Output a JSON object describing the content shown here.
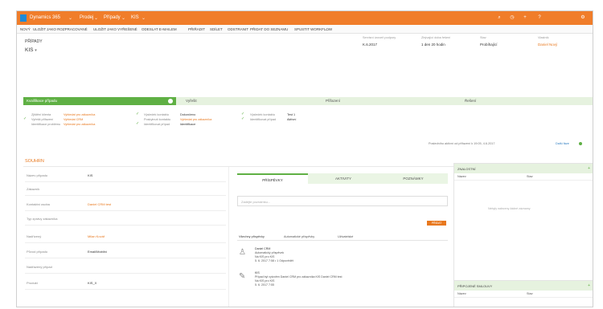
{
  "nav": {
    "app_name": "Dynamics 365",
    "area": "Prodej",
    "entity": "Případy",
    "record": "KIS",
    "right_icons": [
      "search-icon",
      "history-icon",
      "add-icon",
      "help-icon",
      "settings-icon"
    ]
  },
  "commands": [
    "NOVÝ",
    "ULOŽIT JAKO ROZPRACOVANÉ",
    "ULOŽIT JAKO VYŘEŠENÉ",
    "ODESLAT E-MAILEM",
    "PŘIŘADIT",
    "SDÍLET",
    "ODSTRANIT",
    "PŘIDAT DO SEZNAMU",
    "SPUSTIT WORKFLOW",
    "..."
  ],
  "header": {
    "entity_label": "PŘÍPADY",
    "record_name": "KIS",
    "fields": [
      {
        "label": "Servisní úroveň podpory",
        "value": "K.6.2017"
      },
      {
        "label": "Zbývající doba řešení",
        "value": "1 den 20 hodin"
      },
      {
        "label": "Stav",
        "value": "Probíhající"
      },
      {
        "label": "Vlastník",
        "value": "Daniel Nový",
        "orange": true
      }
    ]
  },
  "process": {
    "stages": [
      "Kvalifikace případu",
      "Vyřešit",
      "Přiřazení",
      "Řešení"
    ],
    "active_stage": 0,
    "col1": [
      {
        "label": "Zjištění klienta",
        "value": "Vyhledat pro zákazníka"
      },
      {
        "label": "Vyřešit přiřazení",
        "value": "Vyhledat CRM"
      },
      {
        "label": "Identifikace problému",
        "value": "Vyhledat pro zákazníka"
      }
    ],
    "col2": [
      {
        "label": "Výsledek kontaktu",
        "value": "Dokončeno"
      },
      {
        "label": "Poskytnutí kontaktu",
        "value": "Vyhledat pro zákazníka"
      },
      {
        "label": "Identifikovat případ",
        "value": "Identifikace"
      }
    ],
    "col3": [
      {
        "label": "Výsledek kontaktu",
        "value": "Test 1"
      },
      {
        "label": "Identifikovat případ",
        "value": "Aktivní"
      }
    ],
    "note": "Posledního aktivní od přiřazení k 19:05, 4.6.2017",
    "link": "Další fáze"
  },
  "summary": {
    "title": "SOUHRN",
    "fields": [
      {
        "label": "Název případu",
        "value": "KIS",
        "orange": false
      },
      {
        "label": "Zákazník",
        "value": "",
        "orange": false
      },
      {
        "label": "Kontaktní osoba",
        "value": "Daniel CRM test",
        "orange": true
      },
      {
        "label": "Typ zprávy zákazníka",
        "value": "",
        "orange": false
      },
      {
        "label": "Nadřízený",
        "value": "Milan Kovář",
        "orange": true
      },
      {
        "label": "Původ případu",
        "value": "Email/Mobilní",
        "orange": false
      },
      {
        "label": "Nadřazený případ",
        "value": "",
        "orange": false
      },
      {
        "label": "Produkt",
        "value": "KIS_X",
        "orange": false
      }
    ]
  },
  "timeline": {
    "tabs": [
      "PŘÍSPĚVKY",
      "AKTIVITY",
      "POZNÁMKY"
    ],
    "active_tab": 0,
    "placeholder": "Zadejte poznámku...",
    "add_button": "PŘIDAT",
    "subtabs": [
      "Všechny příspěvky",
      "Automatické příspěvky",
      "Uživatelské"
    ],
    "activities": [
      {
        "icon": "person-icon",
        "lines": [
          "Daniel CRM",
          "Automatický příspěvek",
          "Na KIS pro KIS",
          "5. 6. 2017 7:58 • 1 Odpovědět"
        ]
      },
      {
        "icon": "wrench-icon",
        "lines": [
          "KIS",
          "Případ byl vytvořen Daniel CRM pro zákazníka KIS Daniel CRM test",
          "Na KIS pro KIS",
          "5. 6. 2017 7:55"
        ]
      }
    ]
  },
  "panels": [
    {
      "title": "ZNALOSTNÍ",
      "cols": [
        "Název",
        "Stav"
      ],
      "empty": "Nebyly nalezeny žádné záznamy"
    },
    {
      "title": "PŘIPOJENÉ SMLOUVY",
      "cols": [
        "Název",
        "Stav"
      ],
      "empty": ""
    }
  ],
  "colors": {
    "brand": "#f07d2a",
    "accent": "#5fb044",
    "link": "#e8781e"
  }
}
